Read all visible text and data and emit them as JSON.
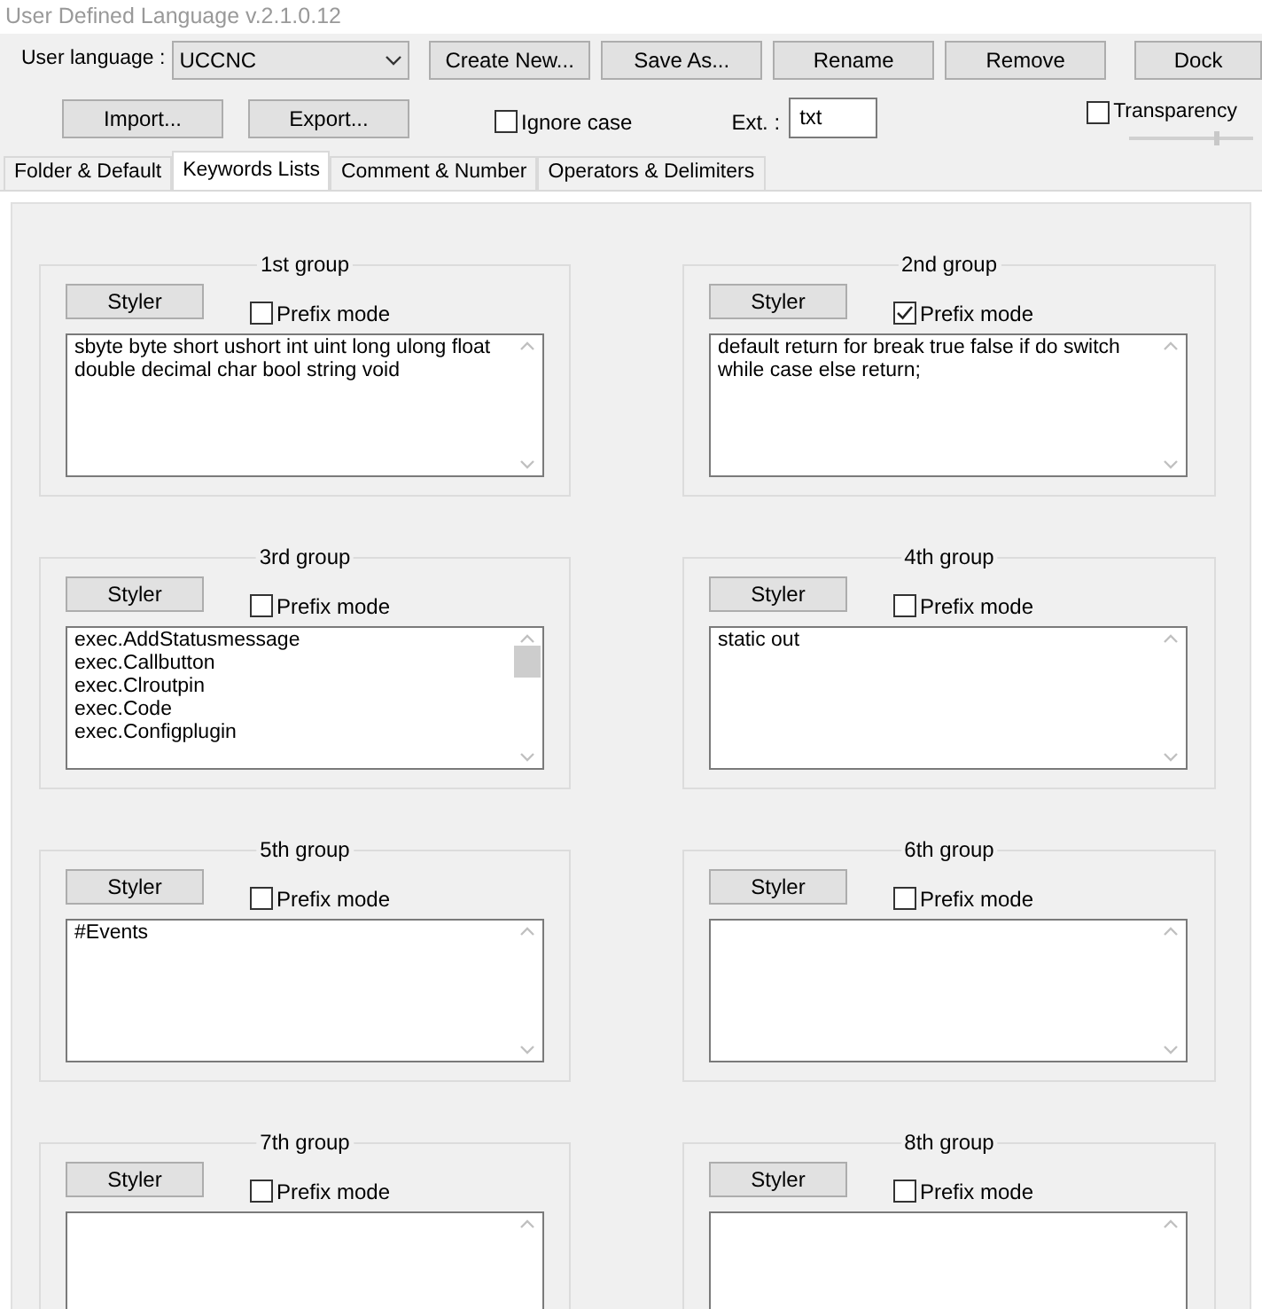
{
  "window": {
    "title": "User Defined Language v.2.1.0.12"
  },
  "language": {
    "label": "User language :",
    "value": "UCCNC"
  },
  "buttons_row1": [
    "Create New...",
    "Save As...",
    "Rename",
    "Remove"
  ],
  "dock": "Dock",
  "buttons_row2": [
    "Import...",
    "Export..."
  ],
  "ignore_case": {
    "label": "Ignore case",
    "checked": false
  },
  "ext": {
    "label": "Ext. :",
    "value": "txt"
  },
  "transparency": {
    "label": "Transparency",
    "checked": false,
    "level": 0.72
  },
  "tabs": [
    {
      "label": "Folder & Default",
      "selected": false
    },
    {
      "label": "Keywords Lists",
      "selected": true
    },
    {
      "label": "Comment & Number",
      "selected": false
    },
    {
      "label": "Operators & Delimiters",
      "selected": false
    }
  ],
  "groups": [
    {
      "title": "1st group",
      "styler": "Styler",
      "prefix_label": "Prefix mode",
      "prefix": false,
      "entries": [
        "sbyte byte short ushort int uint long ulong float double decimal char bool string void"
      ]
    },
    {
      "title": "2nd group",
      "styler": "Styler",
      "prefix_label": "Prefix mode",
      "prefix": true,
      "entries": [
        "default return for break true false if do switch while case else return;"
      ]
    },
    {
      "title": "3rd group",
      "styler": "Styler",
      "prefix_label": "Prefix mode",
      "prefix": false,
      "entries": [
        "exec.AddStatusmessage",
        "exec.Callbutton",
        "exec.Clroutpin",
        "exec.Code",
        "exec.Configplugin"
      ]
    },
    {
      "title": "4th group",
      "styler": "Styler",
      "prefix_label": "Prefix mode",
      "prefix": false,
      "entries": [
        "static out"
      ]
    },
    {
      "title": "5th group",
      "styler": "Styler",
      "prefix_label": "Prefix mode",
      "prefix": false,
      "entries": [
        "#Events"
      ]
    },
    {
      "title": "6th group",
      "styler": "Styler",
      "prefix_label": "Prefix mode",
      "prefix": false
    },
    {
      "title": "7th group",
      "styler": "Styler",
      "prefix_label": "Prefix mode",
      "prefix": false
    },
    {
      "title": "8th group",
      "styler": "Styler",
      "prefix_label": "Prefix mode",
      "prefix": false
    }
  ]
}
